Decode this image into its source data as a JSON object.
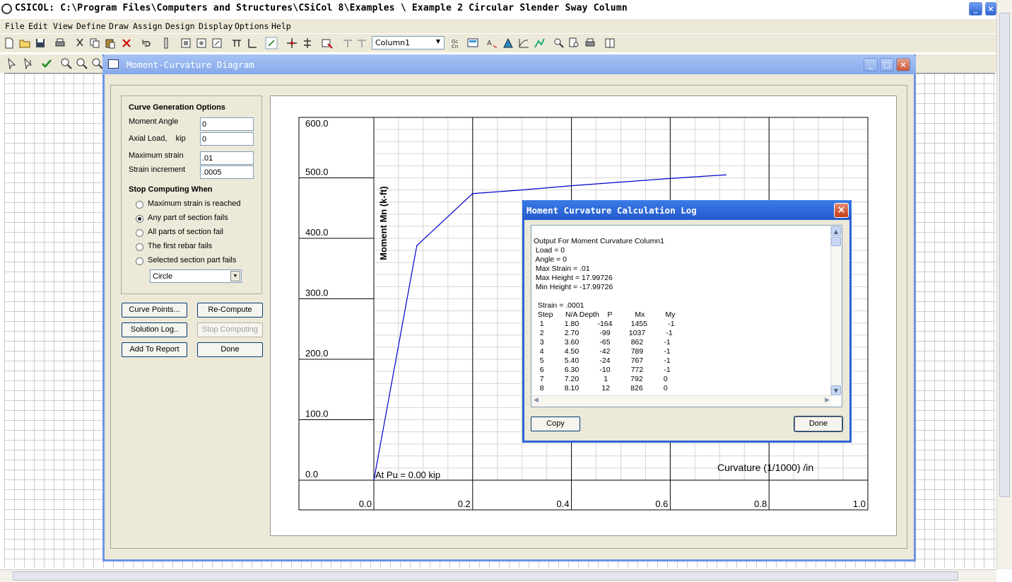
{
  "app": {
    "title": "CSICOL: C:\\Program Files\\Computers and Structures\\CSiCol 8\\Examples \\ Example 2 Circular Slender Sway Column"
  },
  "menu": [
    "File",
    "Edit",
    "View",
    "Define",
    "Draw",
    "Assign",
    "Design",
    "Display",
    "Options",
    "Help"
  ],
  "toolbar": {
    "column_select": "Column1"
  },
  "dialog": {
    "title": "Moment-Curvature Diagram",
    "options": {
      "heading": "Curve Generation Options",
      "moment_angle_label": "Moment Angle",
      "moment_angle_value": "0",
      "axial_load_label": "Axial Load,    kip",
      "axial_load_value": "0",
      "max_strain_label": "Maximum strain",
      "max_strain_value": ".01",
      "strain_inc_label": "Strain increment",
      "strain_inc_value": ".0005"
    },
    "stop": {
      "heading": "Stop Computing When",
      "options": [
        "Maximum strain is reached",
        "Any part of section fails",
        "All parts of section fail",
        "The first rebar fails",
        "Selected section part fails"
      ],
      "selected_index": 1,
      "part": "Circle"
    },
    "buttons": {
      "curve_points": "Curve Points...",
      "recompute": "Re-Compute",
      "solution_log": "Solution Log..",
      "stop_computing": "Stop Computing",
      "add_report": "Add To Report",
      "done": "Done"
    }
  },
  "chart_data": {
    "type": "line",
    "title": "",
    "annotation": "At Pu = 0.00 kip",
    "xlabel": "Curvature (1/1000) /in",
    "ylabel": "Moment Mn (k-ft)",
    "xlim": [
      0,
      1.0
    ],
    "ylim": [
      0,
      600
    ],
    "x_ticks": [
      "0.0",
      "0.2",
      "0.4",
      "0.6",
      "0.8",
      "1.0"
    ],
    "y_ticks": [
      "0.0",
      "100.0",
      "200.0",
      "300.0",
      "400.0",
      "500.0",
      "600.0"
    ],
    "grid": true,
    "series": [
      {
        "color": "#0000cc",
        "x": [
          0.0,
          0.087,
          0.2,
          0.3,
          0.4,
          0.5,
          0.6,
          0.713
        ],
        "y": [
          0,
          388,
          474,
          480,
          487,
          493,
          499,
          505
        ]
      }
    ]
  },
  "log": {
    "title": "Moment Curvature Calculation Log",
    "lines": [
      "Output For Moment Curvature Column1",
      " Load = 0",
      " Angle = 0",
      " Max Strain = .01",
      " Max Height = 17.99726",
      " Min Height = -17.99726",
      "",
      "  Strain = .0001",
      "  Step      N/A Depth    P           Mx          My",
      "   1          1.80         -164         1455          -1",
      "   2          2.70          -99         1037          -1",
      "   3          3.60          -65          862          -1",
      "   4          4.50          -42          789          -1",
      "   5          5.40          -24          767          -1",
      "   6          6.30          -10          772          -1",
      "   7          7.20            1           792          0",
      "   8          8.10           12          826          0"
    ],
    "copy": "Copy",
    "done": "Done"
  }
}
